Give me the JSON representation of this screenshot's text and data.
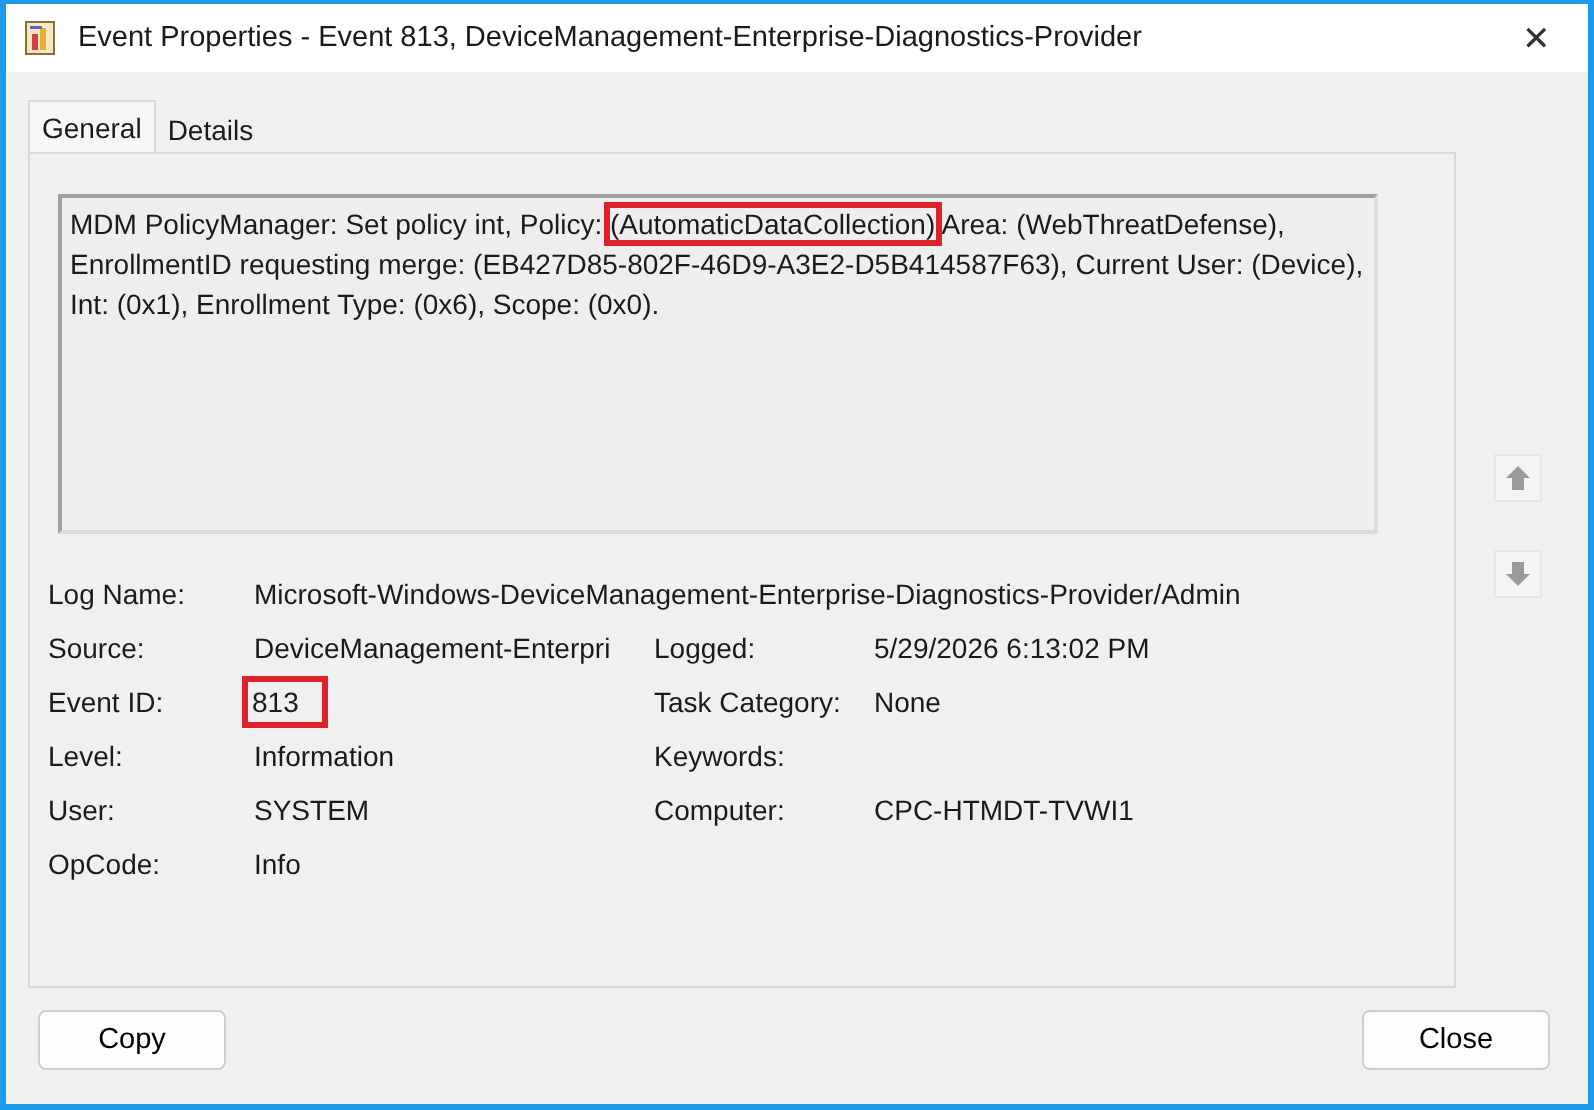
{
  "window": {
    "title": "Event Properties - Event 813, DeviceManagement-Enterprise-Diagnostics-Provider",
    "close": "✕"
  },
  "tabs": [
    {
      "label": "General",
      "selected": true
    },
    {
      "label": "Details",
      "selected": false
    }
  ],
  "message": [
    {
      "text": "MDM PolicyManager: Set policy int, Policy: ",
      "highlighted": false
    },
    {
      "text": "(AutomaticDataCollection)",
      "highlighted": true
    },
    {
      "text": " Area: (WebThreatDefense), EnrollmentID requesting merge: (EB427D85-802F-46D9-A3E2-D5B414587F63), Current User: (Device), Int: (0x1), Enrollment Type: (0x6), Scope: (0x0).",
      "highlighted": false
    }
  ],
  "fields": [
    {
      "cells": [
        {
          "label": "Log Name:",
          "value": "Microsoft-Windows-DeviceManagement-Enterprise-Diagnostics-Provider/Admin",
          "highlighted": false
        }
      ]
    },
    {
      "cells": [
        {
          "label": "Source:",
          "value": "DeviceManagement-Enterpri",
          "highlighted": false
        },
        {
          "label": "Logged:",
          "value": "5/29/2026 6:13:02 PM",
          "highlighted": false
        }
      ]
    },
    {
      "cells": [
        {
          "label": "Event ID:",
          "value": "813",
          "highlighted": true
        },
        {
          "label": "Task Category:",
          "value": "None",
          "highlighted": false
        }
      ]
    },
    {
      "cells": [
        {
          "label": "Level:",
          "value": "Information",
          "highlighted": false
        },
        {
          "label": "Keywords:"
        }
      ]
    },
    {
      "cells": [
        {
          "label": "User:",
          "value": "SYSTEM",
          "highlighted": false
        },
        {
          "label": "Computer:",
          "value": "CPC-HTMDT-TVWI1",
          "highlighted": false
        }
      ]
    },
    {
      "cells": [
        {
          "label": "OpCode:",
          "value": "Info",
          "highlighted": false
        }
      ]
    }
  ],
  "buttons": [
    "Copy",
    "Close"
  ]
}
